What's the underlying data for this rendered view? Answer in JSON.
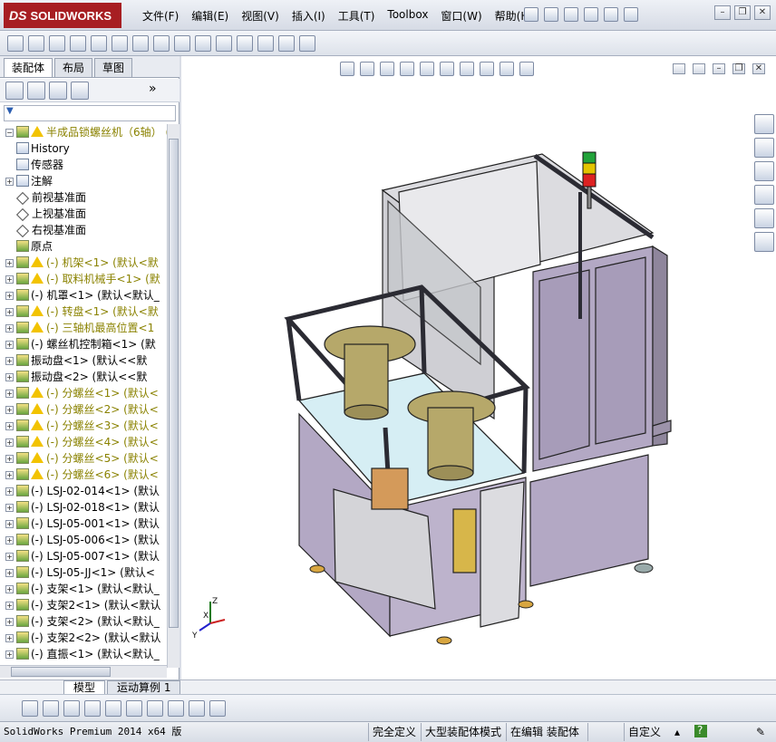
{
  "app": {
    "logo_ds": "DS",
    "logo_text": "SOLIDWORKS"
  },
  "menu": [
    "文件(F)",
    "编辑(E)",
    "视图(V)",
    "插入(I)",
    "工具(T)",
    "Toolbox",
    "窗口(W)",
    "帮助(H)"
  ],
  "left_panel": {
    "tabs": [
      "装配体",
      "布局",
      "草图"
    ],
    "filter_placeholder": "",
    "tree": [
      {
        "label": "半成品锁螺丝机（6轴）  (默",
        "icon": "assembly-icon",
        "warn": true,
        "dim": true,
        "expand": "−"
      },
      {
        "label": "History",
        "icon": "history-icon",
        "warn": false,
        "dim": false,
        "expand": ""
      },
      {
        "label": "传感器",
        "icon": "sensor-icon",
        "warn": false,
        "dim": false,
        "expand": ""
      },
      {
        "label": "注解",
        "icon": "annotation-icon",
        "warn": false,
        "dim": false,
        "expand": "+"
      },
      {
        "label": "前视基准面",
        "icon": "plane-icon",
        "warn": false,
        "dim": false,
        "expand": ""
      },
      {
        "label": "上视基准面",
        "icon": "plane-icon",
        "warn": false,
        "dim": false,
        "expand": ""
      },
      {
        "label": "右视基准面",
        "icon": "plane-icon",
        "warn": false,
        "dim": false,
        "expand": ""
      },
      {
        "label": "原点",
        "icon": "origin-icon",
        "warn": false,
        "dim": false,
        "expand": ""
      },
      {
        "label": "(-) 机架<1> (默认<默",
        "icon": "part-icon",
        "warn": true,
        "dim": true,
        "expand": "+"
      },
      {
        "label": "(-) 取料机械手<1> (默",
        "icon": "part-icon",
        "warn": true,
        "dim": true,
        "expand": "+"
      },
      {
        "label": "(-) 机罩<1> (默认<默认_",
        "icon": "part-icon",
        "warn": false,
        "dim": false,
        "expand": "+"
      },
      {
        "label": "(-) 转盘<1> (默认<默",
        "icon": "part-icon",
        "warn": true,
        "dim": true,
        "expand": "+"
      },
      {
        "label": "(-) 三轴机最高位置<1",
        "icon": "part-icon",
        "warn": true,
        "dim": true,
        "expand": "+"
      },
      {
        "label": "(-) 螺丝机控制箱<1> (默",
        "icon": "part-icon",
        "warn": false,
        "dim": false,
        "expand": "+"
      },
      {
        "label": "振动盘<1> (默认<<默",
        "icon": "part-icon",
        "warn": false,
        "dim": false,
        "expand": "+"
      },
      {
        "label": "振动盘<2> (默认<<默",
        "icon": "part-icon",
        "warn": false,
        "dim": false,
        "expand": "+"
      },
      {
        "label": "(-) 分螺丝<1> (默认<",
        "icon": "part-icon",
        "warn": true,
        "dim": true,
        "expand": "+"
      },
      {
        "label": "(-) 分螺丝<2> (默认<",
        "icon": "part-icon",
        "warn": true,
        "dim": true,
        "expand": "+"
      },
      {
        "label": "(-) 分螺丝<3> (默认<",
        "icon": "part-icon",
        "warn": true,
        "dim": true,
        "expand": "+"
      },
      {
        "label": "(-) 分螺丝<4> (默认<",
        "icon": "part-icon",
        "warn": true,
        "dim": true,
        "expand": "+"
      },
      {
        "label": "(-) 分螺丝<5> (默认<",
        "icon": "part-icon",
        "warn": true,
        "dim": true,
        "expand": "+"
      },
      {
        "label": "(-) 分螺丝<6> (默认<",
        "icon": "part-icon",
        "warn": true,
        "dim": true,
        "expand": "+"
      },
      {
        "label": "(-) LSJ-02-014<1> (默认",
        "icon": "part-icon",
        "warn": false,
        "dim": false,
        "expand": "+"
      },
      {
        "label": "(-) LSJ-02-018<1> (默认",
        "icon": "part-icon",
        "warn": false,
        "dim": false,
        "expand": "+"
      },
      {
        "label": "(-) LSJ-05-001<1> (默认",
        "icon": "part-icon",
        "warn": false,
        "dim": false,
        "expand": "+"
      },
      {
        "label": "(-) LSJ-05-006<1> (默认",
        "icon": "part-icon",
        "warn": false,
        "dim": false,
        "expand": "+"
      },
      {
        "label": "(-) LSJ-05-007<1> (默认",
        "icon": "part-icon",
        "warn": false,
        "dim": false,
        "expand": "+"
      },
      {
        "label": "(-) LSJ-05-JJ<1> (默认<",
        "icon": "part-icon",
        "warn": false,
        "dim": false,
        "expand": "+"
      },
      {
        "label": "(-) 支架<1> (默认<默认_",
        "icon": "part-icon",
        "warn": false,
        "dim": false,
        "expand": "+"
      },
      {
        "label": "(-) 支架2<1> (默认<默认",
        "icon": "part-icon",
        "warn": false,
        "dim": false,
        "expand": "+"
      },
      {
        "label": "(-) 支架<2> (默认<默认_",
        "icon": "part-icon",
        "warn": false,
        "dim": false,
        "expand": "+"
      },
      {
        "label": "(-) 支架2<2> (默认<默认",
        "icon": "part-icon",
        "warn": false,
        "dim": false,
        "expand": "+"
      },
      {
        "label": "(-) 直振<1> (默认<默认_",
        "icon": "part-icon",
        "warn": false,
        "dim": false,
        "expand": "+"
      }
    ]
  },
  "triad": {
    "x": "X",
    "y": "Y",
    "z": "Z"
  },
  "bottom_tabs": [
    "模型",
    "运动算例 1"
  ],
  "status": {
    "version": "SolidWorks Premium 2014 x64 版",
    "fields": [
      "完全定义",
      "大型装配体模式",
      "在编辑 装配体",
      "",
      "自定义",
      "▴"
    ]
  },
  "colors": {
    "accent": "#a71e22",
    "frame_purple": "#b3a8c4",
    "frame_dark": "#2b2b33",
    "glass": "#d6eef4",
    "bowl": "#b6a86a"
  }
}
